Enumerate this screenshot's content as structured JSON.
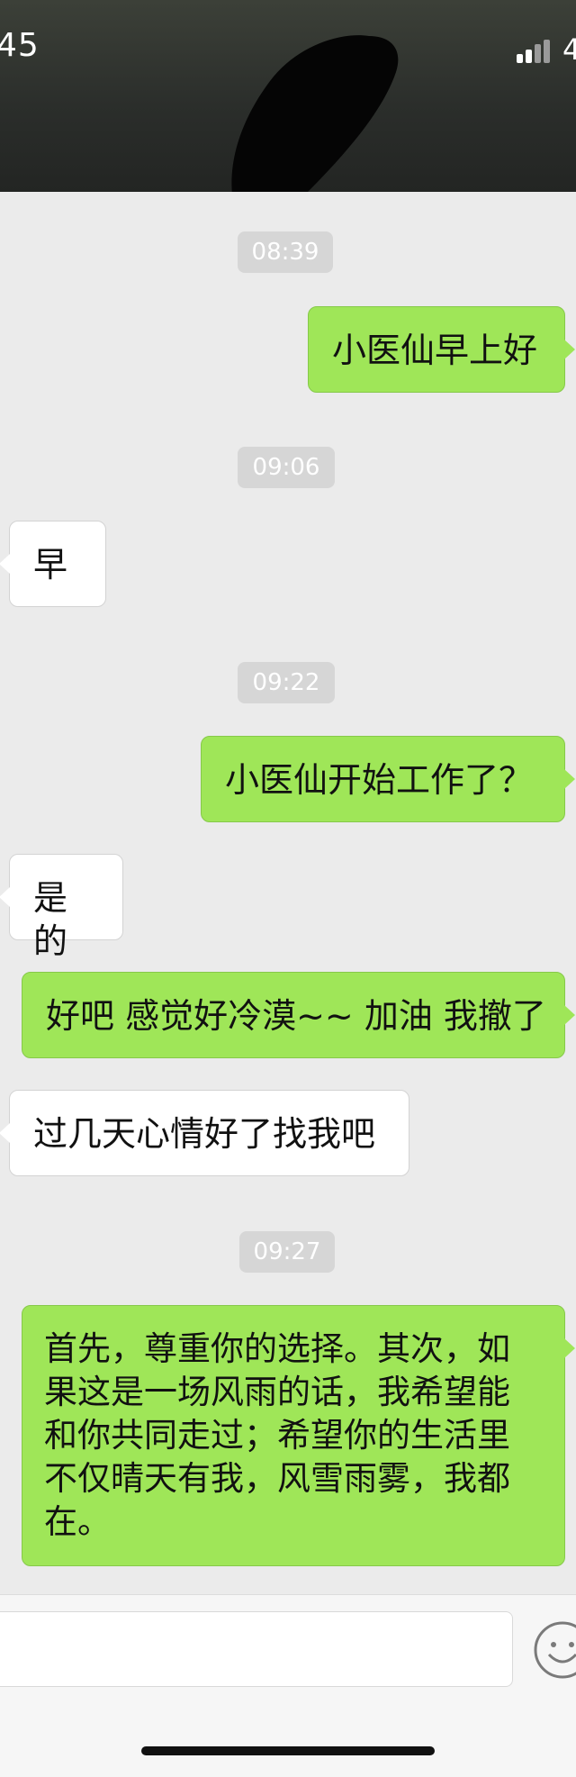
{
  "status_bar": {
    "time": "45",
    "battery": "4"
  },
  "messages": [
    {
      "type": "time",
      "text": "08:39"
    },
    {
      "type": "sent",
      "text": "小医仙早上好"
    },
    {
      "type": "time",
      "text": "09:06"
    },
    {
      "type": "received",
      "text": "早"
    },
    {
      "type": "time",
      "text": "09:22"
    },
    {
      "type": "sent",
      "text": "小医仙开始工作了？"
    },
    {
      "type": "received",
      "text": "是的"
    },
    {
      "type": "sent",
      "text": "好吧 感觉好冷漠~~ 加油 我撤了"
    },
    {
      "type": "received",
      "text": "过几天心情好了找我吧"
    },
    {
      "type": "time",
      "text": "09:27"
    },
    {
      "type": "sent",
      "text": "首先，尊重你的选择。其次，如果这是一场风雨的话，我希望能和你共同走过；希望你的生活里不仅晴天有我，风雪雨雾，我都在。"
    }
  ],
  "input_bar": {
    "placeholder": ""
  },
  "colors": {
    "sent_bubble": "#9fe658",
    "received_bubble": "#ffffff",
    "background": "#ebebeb"
  }
}
